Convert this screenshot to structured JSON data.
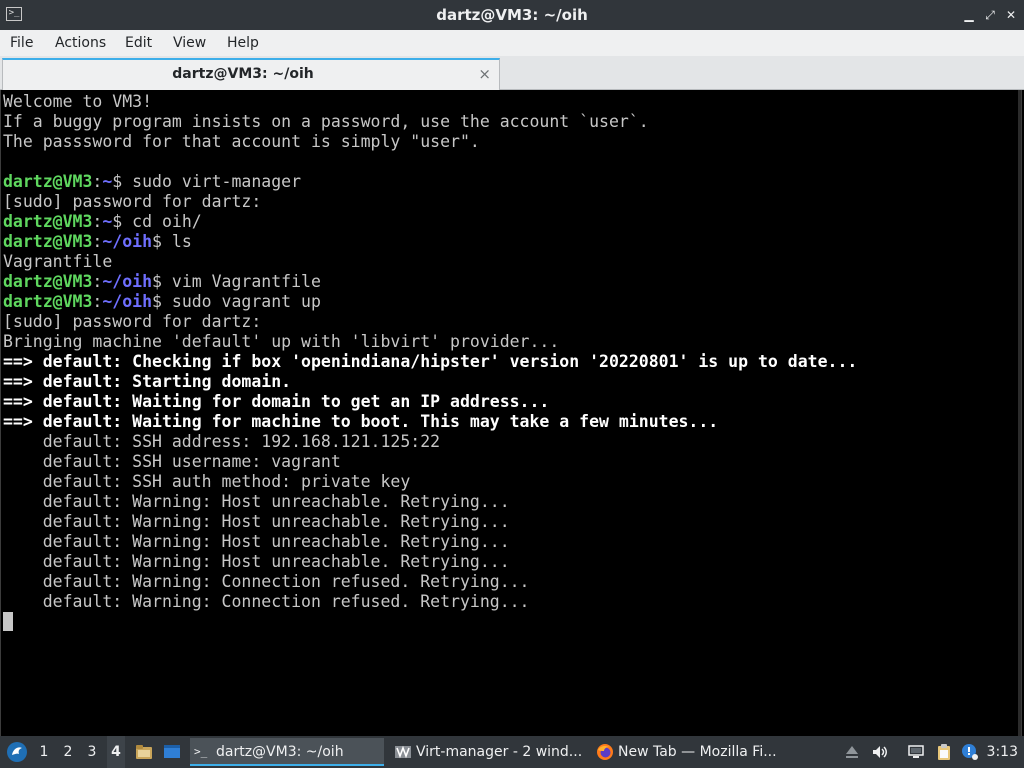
{
  "window": {
    "title": "dartz@VM3: ~/oih",
    "app_icon_text": ">_",
    "controls": {
      "minimize": "▁",
      "restore": "⤢",
      "close": "✕"
    }
  },
  "menu": [
    "File",
    "Actions",
    "Edit",
    "View",
    "Help"
  ],
  "tab": {
    "label": "dartz@VM3: ~/oih",
    "close": "×"
  },
  "terminal": {
    "lines": [
      [
        {
          "t": "Welcome to VM3!",
          "c": "n"
        }
      ],
      [
        {
          "t": "If a buggy program insists on a password, use the account `user`.",
          "c": "n"
        }
      ],
      [
        {
          "t": "The passsword for that account is simply \"user\".",
          "c": "n"
        }
      ],
      [
        {
          "t": "",
          "c": "n"
        }
      ],
      [
        {
          "t": "dartz@VM3",
          "c": "u"
        },
        {
          "t": ":",
          "c": "s"
        },
        {
          "t": "~",
          "c": "p"
        },
        {
          "t": "$ sudo virt-manager",
          "c": "n"
        }
      ],
      [
        {
          "t": "[sudo] password for dartz:",
          "c": "n"
        }
      ],
      [
        {
          "t": "dartz@VM3",
          "c": "u"
        },
        {
          "t": ":",
          "c": "s"
        },
        {
          "t": "~",
          "c": "p"
        },
        {
          "t": "$ cd oih/",
          "c": "n"
        }
      ],
      [
        {
          "t": "dartz@VM3",
          "c": "u"
        },
        {
          "t": ":",
          "c": "s"
        },
        {
          "t": "~/oih",
          "c": "p"
        },
        {
          "t": "$ ls",
          "c": "n"
        }
      ],
      [
        {
          "t": "Vagrantfile",
          "c": "n"
        }
      ],
      [
        {
          "t": "dartz@VM3",
          "c": "u"
        },
        {
          "t": ":",
          "c": "s"
        },
        {
          "t": "~/oih",
          "c": "p"
        },
        {
          "t": "$ vim Vagrantfile",
          "c": "n"
        }
      ],
      [
        {
          "t": "dartz@VM3",
          "c": "u"
        },
        {
          "t": ":",
          "c": "s"
        },
        {
          "t": "~/oih",
          "c": "p"
        },
        {
          "t": "$ sudo vagrant up",
          "c": "n"
        }
      ],
      [
        {
          "t": "[sudo] password for dartz:",
          "c": "n"
        }
      ],
      [
        {
          "t": "Bringing machine 'default' up with 'libvirt' provider...",
          "c": "n"
        }
      ],
      [
        {
          "t": "==> default: Checking if box 'openindiana/hipster' version '20220801' is up to date...",
          "c": "b"
        }
      ],
      [
        {
          "t": "==> default: Starting domain.",
          "c": "b"
        }
      ],
      [
        {
          "t": "==> default: Waiting for domain to get an IP address...",
          "c": "b"
        }
      ],
      [
        {
          "t": "==> default: Waiting for machine to boot. This may take a few minutes...",
          "c": "b"
        }
      ],
      [
        {
          "t": "    default: SSH address: 192.168.121.125:22",
          "c": "n"
        }
      ],
      [
        {
          "t": "    default: SSH username: vagrant",
          "c": "n"
        }
      ],
      [
        {
          "t": "    default: SSH auth method: private key",
          "c": "n"
        }
      ],
      [
        {
          "t": "    default: Warning: Host unreachable. Retrying...",
          "c": "n"
        }
      ],
      [
        {
          "t": "    default: Warning: Host unreachable. Retrying...",
          "c": "n"
        }
      ],
      [
        {
          "t": "    default: Warning: Host unreachable. Retrying...",
          "c": "n"
        }
      ],
      [
        {
          "t": "    default: Warning: Host unreachable. Retrying...",
          "c": "n"
        }
      ],
      [
        {
          "t": "    default: Warning: Connection refused. Retrying...",
          "c": "n"
        }
      ],
      [
        {
          "t": "    default: Warning: Connection refused. Retrying...",
          "c": "n"
        }
      ]
    ]
  },
  "taskbar": {
    "desktops": [
      "1",
      "2",
      "3",
      "4"
    ],
    "active_desktop": "4",
    "tasks": [
      {
        "label": "dartz@VM3: ~/oih",
        "icon": "terminal-icon",
        "active": true
      },
      {
        "label": "Virt-manager - 2 wind...",
        "icon": "virt-manager-icon",
        "active": false
      },
      {
        "label": "New Tab — Mozilla Fi...",
        "icon": "firefox-icon",
        "active": false
      }
    ],
    "tray_icons": [
      "eject-icon",
      "volume-icon",
      "network-icon",
      "clipboard-icon",
      "update-notifier-icon"
    ],
    "clock": "3:13"
  },
  "colors": {
    "prompt_user": "#5fd85f",
    "prompt_path": "#6f6fff",
    "terminal_bg": "#000000",
    "terminal_fg": "#c7c7c7",
    "accent": "#3daee9"
  }
}
